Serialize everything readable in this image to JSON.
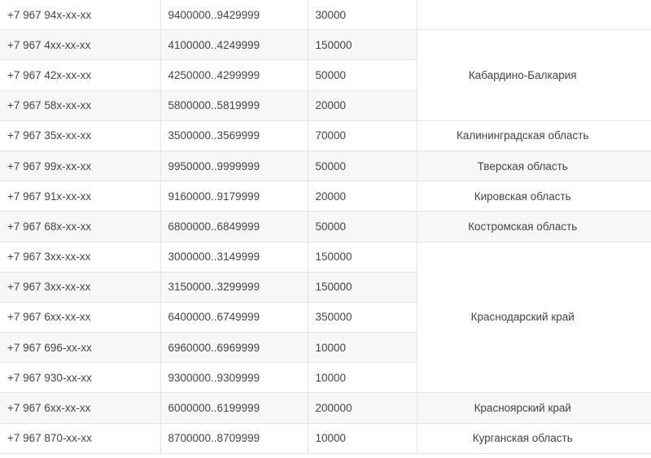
{
  "rows": [
    {
      "prefix": "+7 967 94x-xx-xx",
      "range": "9400000..9429999",
      "capacity": "30000"
    },
    {
      "prefix": "+7 967 4xx-xx-xx",
      "range": "4100000..4249999",
      "capacity": "150000"
    },
    {
      "prefix": "+7 967 42x-xx-xx",
      "range": "4250000..4299999",
      "capacity": "50000"
    },
    {
      "prefix": "+7 967 58x-xx-xx",
      "range": "5800000..5819999",
      "capacity": "20000"
    },
    {
      "prefix": "+7 967 35x-xx-xx",
      "range": "3500000..3569999",
      "capacity": "70000"
    },
    {
      "prefix": "+7 967 99x-xx-xx",
      "range": "9950000..9999999",
      "capacity": "50000"
    },
    {
      "prefix": "+7 967 91x-xx-xx",
      "range": "9160000..9179999",
      "capacity": "20000"
    },
    {
      "prefix": "+7 967 68x-xx-xx",
      "range": "6800000..6849999",
      "capacity": "50000"
    },
    {
      "prefix": "+7 967 3xx-xx-xx",
      "range": "3000000..3149999",
      "capacity": "150000"
    },
    {
      "prefix": "+7 967 3xx-xx-xx",
      "range": "3150000..3299999",
      "capacity": "150000"
    },
    {
      "prefix": "+7 967 6xx-xx-xx",
      "range": "6400000..6749999",
      "capacity": "350000"
    },
    {
      "prefix": "+7 967 696-xx-xx",
      "range": "6960000..6969999",
      "capacity": "10000"
    },
    {
      "prefix": "+7 967 930-xx-xx",
      "range": "9300000..9309999",
      "capacity": "10000"
    },
    {
      "prefix": "+7 967 6xx-xx-xx",
      "range": "6000000..6199999",
      "capacity": "200000"
    },
    {
      "prefix": "+7 967 870-xx-xx",
      "range": "8700000..8709999",
      "capacity": "10000"
    }
  ],
  "regions": [
    {
      "name": "",
      "rows": 1
    },
    {
      "name": "Кабардино-Балкария",
      "rows": 3
    },
    {
      "name": "Калининградская область",
      "rows": 1
    },
    {
      "name": "Тверская область",
      "rows": 1
    },
    {
      "name": "Кировская область",
      "rows": 1
    },
    {
      "name": "Костромская область",
      "rows": 1
    },
    {
      "name": "Краснодарский край",
      "rows": 5
    },
    {
      "name": "Красноярский край",
      "rows": 1
    },
    {
      "name": "Курганская область",
      "rows": 1
    }
  ]
}
